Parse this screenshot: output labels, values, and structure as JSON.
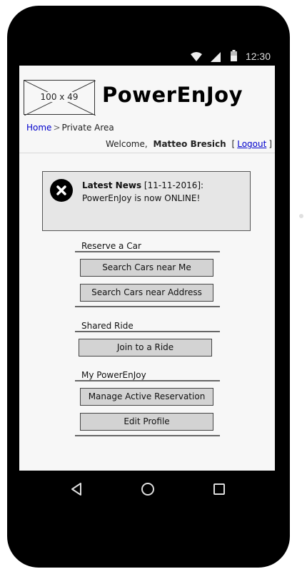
{
  "status_bar": {
    "time": "12:30",
    "icons": [
      "wifi-icon",
      "signal-icon",
      "battery-icon"
    ]
  },
  "header": {
    "logo_placeholder": "100 x 49",
    "app_title": "PowerEnJoy"
  },
  "breadcrumb": {
    "home": "Home",
    "separator": ">",
    "current": "Private Area"
  },
  "welcome": {
    "prefix": "Welcome,",
    "user_name": "Matteo Bresich",
    "bracket_open": "[",
    "logout_label": "Logout",
    "bracket_close": "]"
  },
  "news": {
    "icon": "close-circle-icon",
    "headline": "Latest News",
    "date": "[11-11-2016]:",
    "body": "PowerEnJoy is now ONLINE!"
  },
  "sections": {
    "reserve": {
      "label": "Reserve a Car",
      "buttons": {
        "search_near_me": "Search Cars near Me",
        "search_near_address": "Search Cars near Address"
      }
    },
    "shared": {
      "label": "Shared Ride",
      "buttons": {
        "join_ride": "Join to a Ride"
      }
    },
    "my": {
      "label": "My PowerEnJoy",
      "buttons": {
        "manage_reservation": "Manage Active Reservation",
        "edit_profile": "Edit Profile"
      }
    }
  },
  "nav_bar": {
    "icons": [
      "back-icon",
      "home-icon",
      "recents-icon"
    ]
  },
  "colors": {
    "link": "#0000cc",
    "phone_body": "#000000",
    "screen_bg": "#f7f7f7",
    "button_bg": "#d3d3d3"
  }
}
